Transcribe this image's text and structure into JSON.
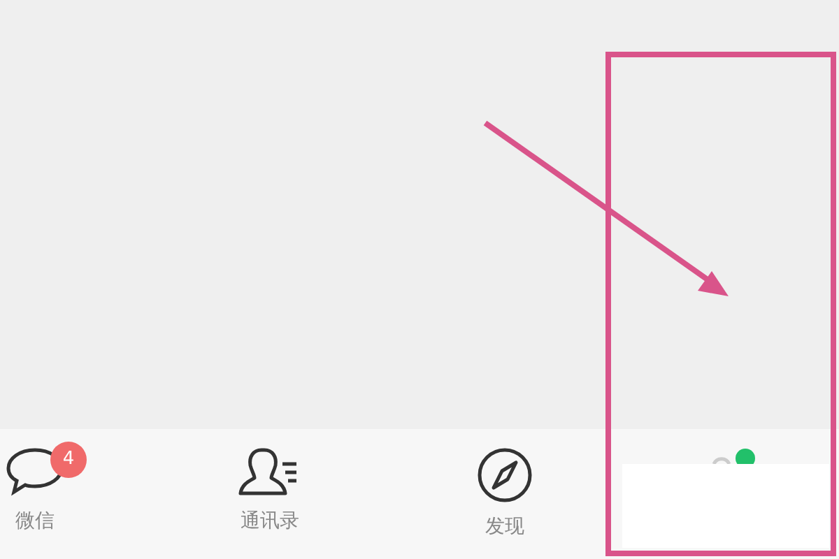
{
  "tabs": [
    {
      "kind": "chat",
      "label": "微信",
      "badge": "4",
      "dot": false
    },
    {
      "kind": "contacts",
      "label": "通讯录",
      "dot": false
    },
    {
      "kind": "discover",
      "label": "发现",
      "dot": false
    },
    {
      "kind": "me",
      "dot": true
    }
  ],
  "annotations": [
    {
      "kind": "arrow"
    },
    {
      "kind": "box"
    },
    {
      "kind": "cover"
    }
  ]
}
